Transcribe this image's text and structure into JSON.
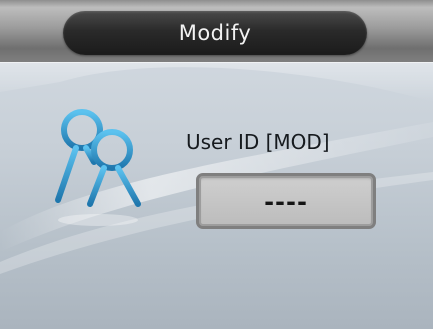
{
  "header": {
    "title": "Modify"
  },
  "form": {
    "label": "User ID [MOD]",
    "value": "----"
  },
  "icons": {
    "users": "users-icon"
  },
  "colors": {
    "title_pill": "#1f1f1f",
    "icon_blue": "#3b9fd0",
    "box_border": "#7f7f7f"
  }
}
